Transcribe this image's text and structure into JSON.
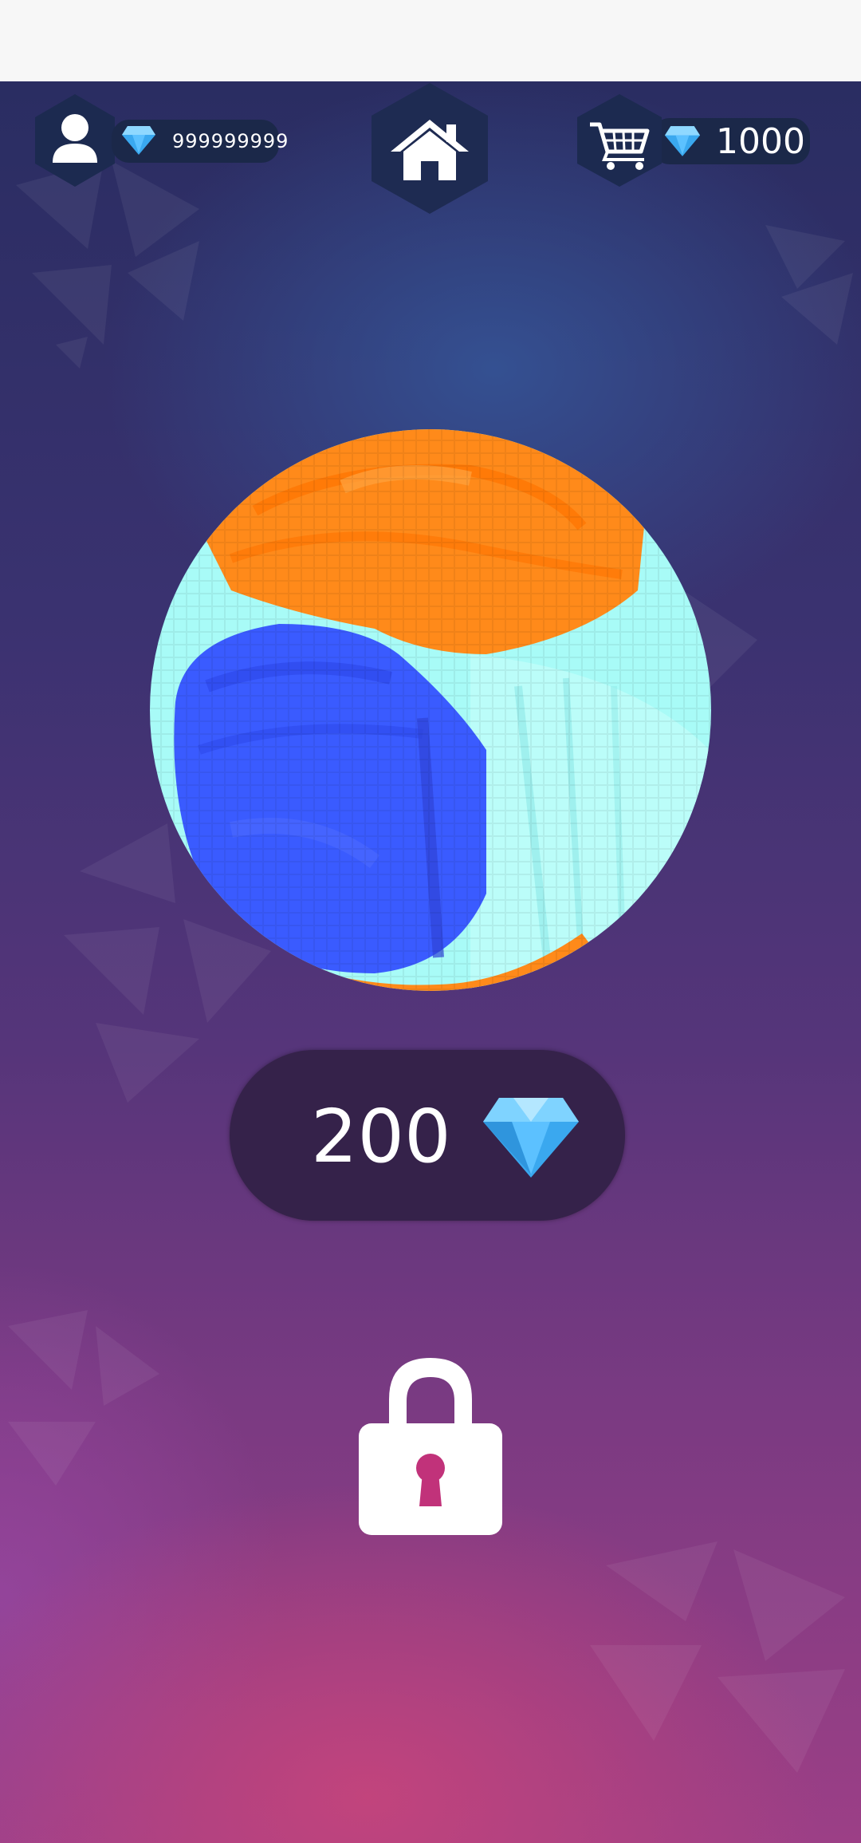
{
  "hud": {
    "player_gems": "999999999",
    "shop_gems": "1000"
  },
  "item": {
    "price": "200",
    "locked": true
  },
  "icons": {
    "profile": "user-icon",
    "home": "home-icon",
    "shop": "cart-icon",
    "gem": "diamond-icon",
    "lock": "lock-icon"
  },
  "colors": {
    "orange": "#ff8a1a",
    "blue": "#3a5bff",
    "cyan": "#a8fbf7",
    "gem": "#4ab8ff"
  }
}
